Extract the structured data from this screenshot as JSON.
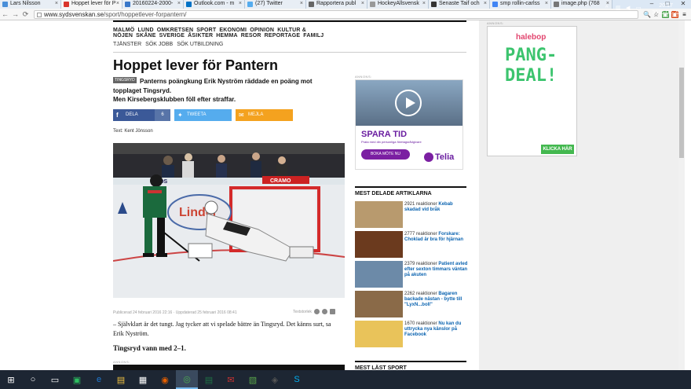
{
  "browser": {
    "tabs": [
      {
        "label": "Lars Nilsson",
        "color": "#4a8fd9"
      },
      {
        "label": "Hoppet lever för P",
        "color": "#d9342b",
        "active": true
      },
      {
        "label": "20160224-2000-",
        "color": "#3a78c9"
      },
      {
        "label": "Outlook.com - m",
        "color": "#0072c6"
      },
      {
        "label": "(27) Twitter",
        "color": "#55acee"
      },
      {
        "label": "Rapportera publ",
        "color": "#666666"
      },
      {
        "label": "HockeyAllsvensk",
        "color": "#999999"
      },
      {
        "label": "Senaste Taif och",
        "color": "#333333"
      },
      {
        "label": "smp rollin-carlss",
        "color": "#4285f4"
      },
      {
        "label": "image.php (768",
        "color": "#777777"
      }
    ],
    "url_host": "www.sydsvenskan.se",
    "url_path": "/sport/hoppetlever-forpantern/",
    "window_controls": [
      "–",
      "□",
      "✕"
    ]
  },
  "site": {
    "nav_primary": [
      "MALMÖ",
      "LUND",
      "OMKRETSEN",
      "SPORT",
      "EKONOMI",
      "OPINION",
      "KULTUR & NÖJEN",
      "SKÅNE",
      "SVERIGE",
      "ÅSIKTER",
      "HEMMA",
      "RESOR",
      "REPORTAGE",
      "FAMILJ"
    ],
    "nav_secondary": [
      "TJÄNSTER",
      "SÖK JOBB",
      "SÖK UTBILDNING"
    ]
  },
  "article": {
    "headline": "Hoppet lever för Pantern",
    "tag": "TINGSRYD",
    "lead1": "Panterns poängkung Erik Nyström räddade en poäng mot",
    "lead2": "topplaget Tingsryd.",
    "lead3": "Men Kirsebergsklubben föll efter straffar.",
    "share": {
      "facebook_label": "DELA",
      "facebook_count": "6",
      "twitter_label": "TWEETA",
      "mail_label": "MEJLA"
    },
    "byline": "Text: Kent Jönsson",
    "photo_texts": {
      "sign1": "RYDS",
      "sign2": "Linder",
      "sign3": "CRAMO"
    },
    "meta": "Publicerad 24 februari 2016 22:16 · Uppdaterad 25 februari 2016 08:41",
    "textsize_label": "Textstorlek",
    "body1": "– Självklart är det tungt. Jag tycker att vi spelade bättre än Tingsryd. Det känns surt, sa Erik Nyström.",
    "body2": "Tingsryd vann med 2–1.",
    "annons_label": "ANNONS:"
  },
  "sidebar": {
    "annons_label": "ANNONS:",
    "telia_ad": {
      "headline": "SPARA TID",
      "sub": "Prata med din personliga företagsrådgivare",
      "button": "BOKA MÖTE NU",
      "logo": "Telia"
    },
    "most_shared_title": "MEST DELADE ARTIKLARNA",
    "most_shared": [
      {
        "count": "2921 reaktioner",
        "title": "Kebab skadad vid bråk",
        "color": "#b89a6e"
      },
      {
        "count": "2777 reaktioner",
        "title": "Forskare: Choklad är bra för hjärnan",
        "color": "#6b3a1e"
      },
      {
        "count": "2379 reaktioner",
        "title": "Patient avled efter sexton timmars väntan på akuten",
        "color": "#6c8aa8"
      },
      {
        "count": "2262 reaktioner",
        "title": "Bagaren backade nästan - bytte till \"LyxN...boll\"",
        "color": "#8a6a48"
      },
      {
        "count": "1670 reaktioner",
        "title": "Nu kan du uttrycka nya känslor på Facebook",
        "color": "#e9c35a"
      }
    ],
    "most_read_title": "MEST LÄST SPORT"
  },
  "gutter_ad": {
    "annons_label": "ANNONS:",
    "brand": "halebop",
    "line1": "PANG-",
    "line2": "DEAL!",
    "button": "KLICKA HÄR"
  },
  "taskbar": {
    "apps": [
      "start",
      "search",
      "taskview",
      "evernote",
      "edge",
      "explorer",
      "store",
      "firefox",
      "chrome",
      "excel",
      "mail",
      "photos",
      "media",
      "skype"
    ],
    "time": "20:17",
    "date": "2016-02-25"
  }
}
